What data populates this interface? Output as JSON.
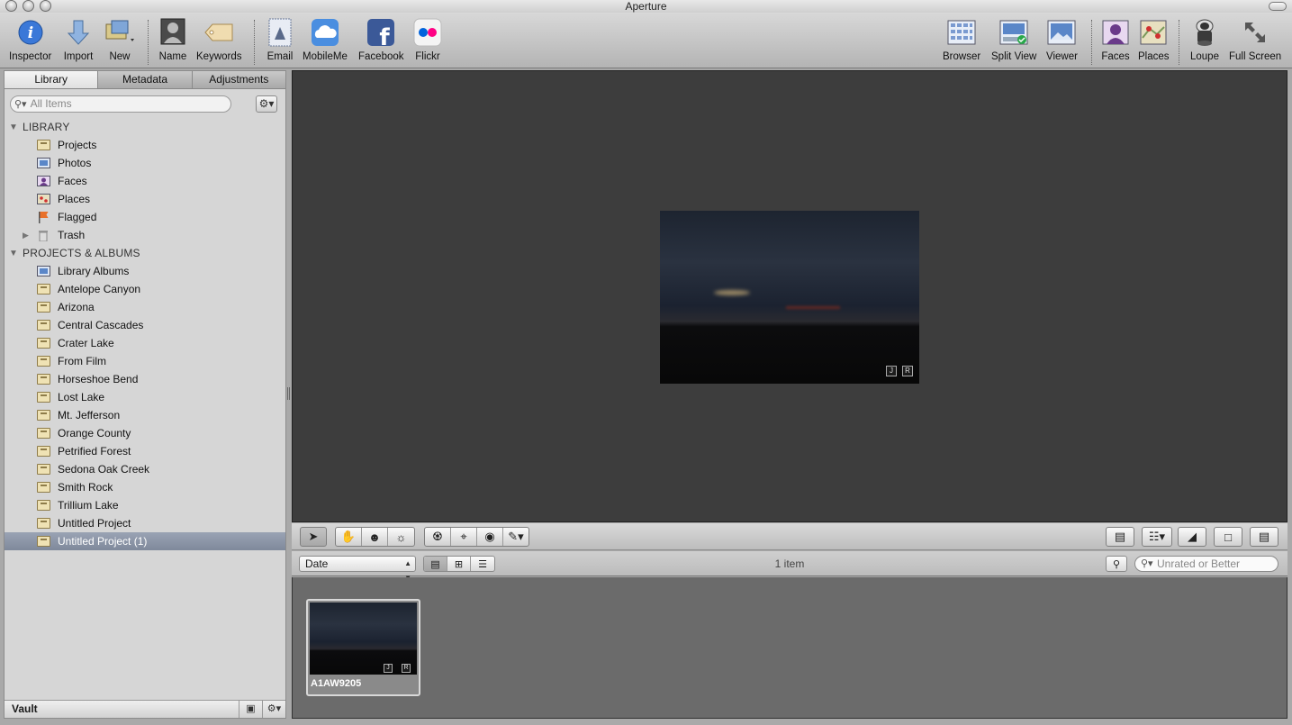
{
  "window": {
    "title": "Aperture"
  },
  "toolbar": {
    "inspector": "Inspector",
    "import": "Import",
    "new": "New",
    "name": "Name",
    "keywords": "Keywords",
    "email": "Email",
    "mobileme": "MobileMe",
    "facebook": "Facebook",
    "flickr": "Flickr",
    "browser": "Browser",
    "split_view": "Split View",
    "viewer": "Viewer",
    "faces": "Faces",
    "places": "Places",
    "loupe": "Loupe",
    "full_screen": "Full Screen"
  },
  "inspector_tabs": {
    "library": "Library",
    "metadata": "Metadata",
    "adjustments": "Adjustments"
  },
  "search": {
    "placeholder": "All Items"
  },
  "library": {
    "header": "LIBRARY",
    "items": [
      "Projects",
      "Photos",
      "Faces",
      "Places",
      "Flagged",
      "Trash"
    ]
  },
  "projects": {
    "header": "PROJECTS & ALBUMS",
    "items": [
      "Library Albums",
      "Antelope Canyon",
      "Arizona",
      "Central Cascades",
      "Crater Lake",
      "From Film",
      "Horseshoe Bend",
      "Lost Lake",
      "Mt. Jefferson",
      "Orange County",
      "Petrified Forest",
      "Sedona Oak Creek",
      "Smith Rock",
      "Trillium Lake",
      "Untitled Project",
      "Untitled Project (1)"
    ],
    "selected": "Untitled Project (1)"
  },
  "vault": {
    "label": "Vault"
  },
  "photo": {
    "badge_j": "J",
    "badge_r": "R"
  },
  "browser": {
    "sort_label": "Date",
    "item_count": "1 item",
    "rating_filter": "Unrated or Better",
    "thumb_name": "A1AW9205"
  }
}
